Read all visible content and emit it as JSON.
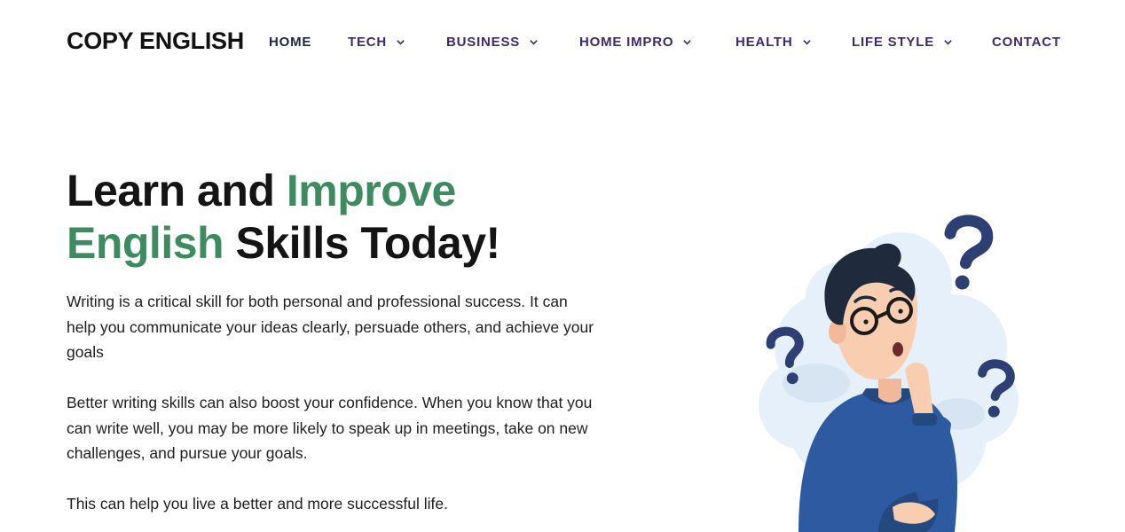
{
  "header": {
    "logo": "COPY ENGLISH",
    "nav": [
      {
        "label": "HOME",
        "dropdown": false
      },
      {
        "label": "TECH",
        "dropdown": true
      },
      {
        "label": "BUSINESS",
        "dropdown": true
      },
      {
        "label": "HOME IMPRO",
        "dropdown": true
      },
      {
        "label": "HEALTH",
        "dropdown": true
      },
      {
        "label": "LIFE STYLE",
        "dropdown": true
      },
      {
        "label": "CONTACT",
        "dropdown": false
      }
    ]
  },
  "hero": {
    "title_part1": "Learn and ",
    "title_highlight1": "Improve",
    "title_highlight2": "English",
    "title_part2": " Skills Today!",
    "paragraphs": [
      "Writing is a critical skill for both personal and professional success. It can help you communicate your ideas clearly, persuade others, and achieve your goals",
      "Better writing skills can also boost your confidence. When you know that you can write well, you may be more likely to speak up in meetings, take on new challenges, and pursue your goals.",
      "This can help you live a better and more successful life."
    ],
    "illustration": "thinking-man-with-question-marks"
  },
  "colors": {
    "accent_green": "#3e8a61",
    "nav_purple": "#3d2a6e",
    "text_dark": "#141414",
    "question_mark": "#2d3f73",
    "sweater_blue": "#2d5aa0"
  }
}
